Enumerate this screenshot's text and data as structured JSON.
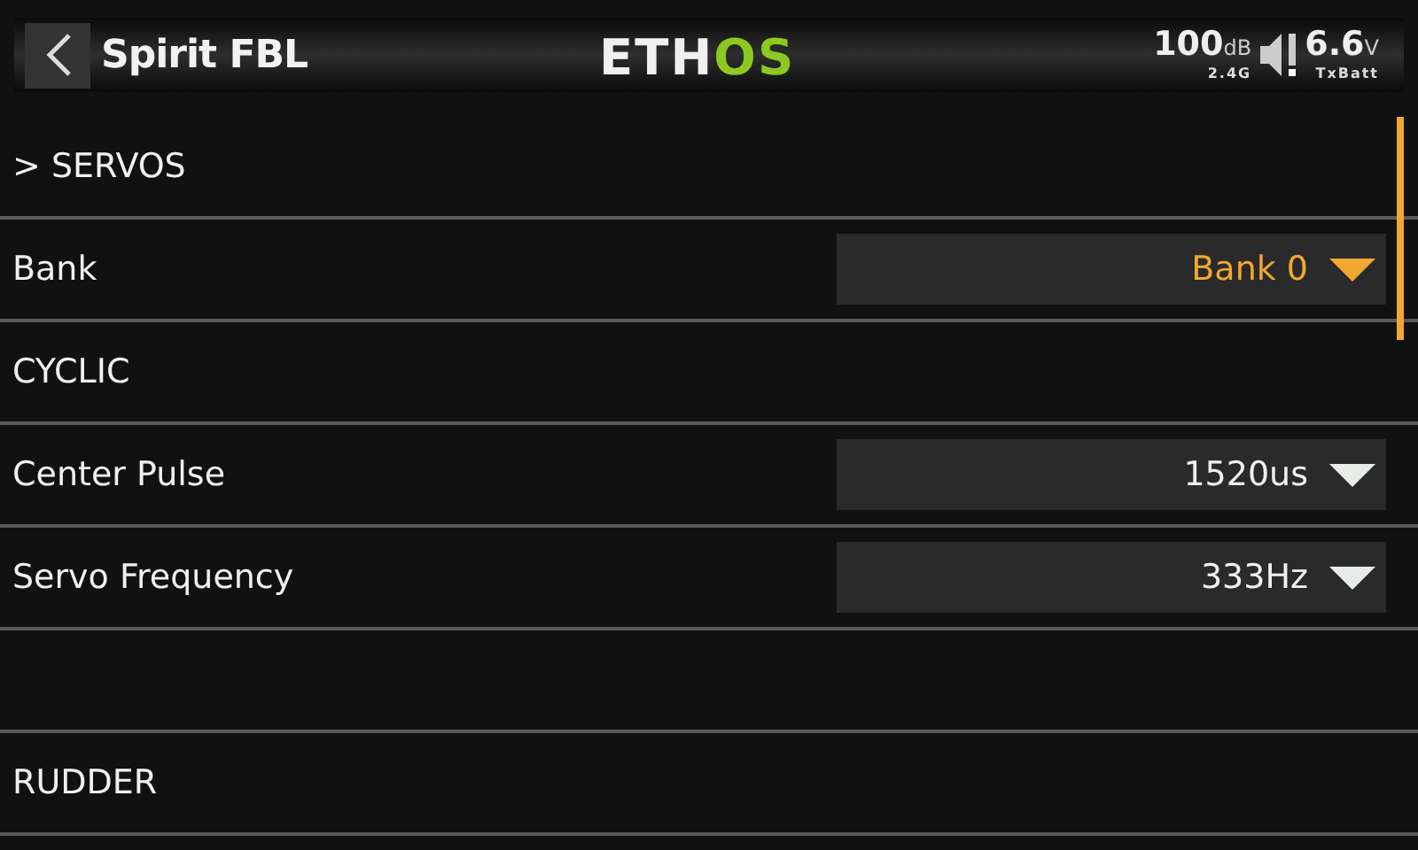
{
  "header": {
    "title": "Spirit FBL",
    "logo": {
      "part_1": "ETH",
      "part_2": "OS"
    },
    "rssi": {
      "value": "100",
      "unit": "dB",
      "band": "2.4G"
    },
    "battery": {
      "value": "6.6",
      "unit": "V",
      "label": "TxBatt"
    }
  },
  "rows": [
    {
      "kind": "section",
      "label": "> SERVOS"
    },
    {
      "kind": "choice",
      "label": "Bank",
      "value": "Bank 0",
      "selected": true
    },
    {
      "kind": "section",
      "label": "CYCLIC"
    },
    {
      "kind": "choice",
      "label": "Center Pulse",
      "value": "1520us",
      "selected": false
    },
    {
      "kind": "choice",
      "label": "Servo Frequency",
      "value": "333Hz",
      "selected": false
    },
    {
      "kind": "blank"
    },
    {
      "kind": "section",
      "label": "RUDDER"
    }
  ]
}
